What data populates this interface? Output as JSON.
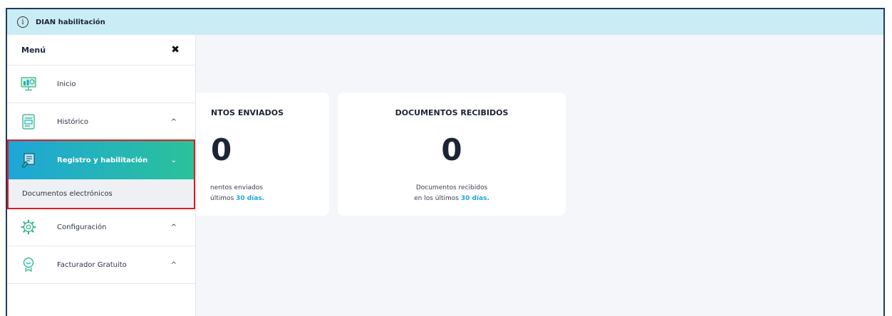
{
  "topbar": {
    "title": "DIAN habilitación",
    "icon": "info-icon"
  },
  "menu": {
    "title": "Menú",
    "close_glyph": "✖",
    "items": [
      {
        "label": "Inicio",
        "icon": "dashboard-monitor-icon",
        "chevron": ""
      },
      {
        "label": "Histórico",
        "icon": "history-document-icon",
        "chevron": "^"
      },
      {
        "label": "Registro y habilitación",
        "icon": "registration-icon",
        "chevron": "⌄"
      },
      {
        "label": "Configuración",
        "icon": "gear-icon",
        "chevron": "^"
      },
      {
        "label": "Facturador Gratuito",
        "icon": "free-invoicer-icon",
        "chevron": "^"
      }
    ],
    "subitem": "Documentos electrónicos"
  },
  "cards": [
    {
      "title": "NTOS ENVIADOS",
      "value": "0",
      "desc_line1": "nentos enviados",
      "desc_line2_prefix": "últimos ",
      "desc_line2_accent": "30 días."
    },
    {
      "title": "DOCUMENTOS RECIBIDOS",
      "value": "0",
      "desc_line1": "Documentos recibidos",
      "desc_line2_prefix": "en los últimos ",
      "desc_line2_accent": "30 días."
    }
  ],
  "colors": {
    "topbar_bg": "#c9ecf5",
    "active_gradient_start": "#1ea6d8",
    "active_gradient_end": "#2bc29a",
    "accent": "#1ea6d8",
    "highlight_border": "#e01b1b"
  }
}
